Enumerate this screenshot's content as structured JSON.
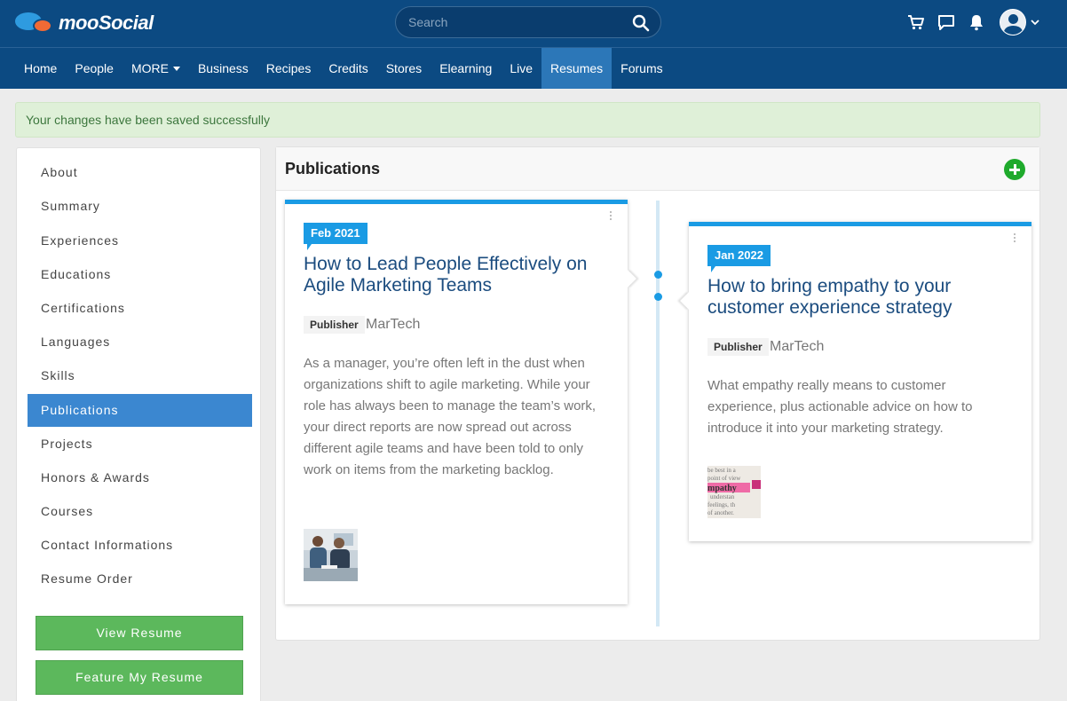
{
  "app": {
    "logo_text": "mooSocial",
    "search_placeholder": "Search"
  },
  "nav": {
    "items": [
      "Home",
      "People",
      "MORE",
      "Business",
      "Recipes",
      "Credits",
      "Stores",
      "Elearning",
      "Live",
      "Resumes",
      "Forums"
    ],
    "active": "Resumes"
  },
  "alert": {
    "message": "Your changes have been saved successfully"
  },
  "sidebar": {
    "items": [
      "About",
      "Summary",
      "Experiences",
      "Educations",
      "Certifications",
      "Languages",
      "Skills",
      "Publications",
      "Projects",
      "Honors & Awards",
      "Courses",
      "Contact Informations",
      "Resume Order"
    ],
    "active": "Publications",
    "view_resume_label": "View Resume",
    "feature_resume_label": "Feature My Resume"
  },
  "panel": {
    "title": "Publications"
  },
  "publications": [
    {
      "date": "Feb 2021",
      "title": "How to Lead People Effectively on Agile Marketing Teams",
      "publisher_label": "Publisher",
      "publisher": "MarTech",
      "description": "As a manager, you’re often left in the dust when organizations shift to agile marketing. While your role has always been to manage the team’s work, your direct reports are now spread out across different agile teams and have been told to only work on items from the marketing backlog."
    },
    {
      "date": "Jan 2022",
      "title": "How to bring empathy to your customer experience strategy",
      "publisher_label": "Publisher",
      "publisher": "MarTech",
      "description": "What empathy really means to customer experience, plus actionable advice on how to introduce it into your marketing strategy.",
      "thumb_words": [
        "be best in a",
        "point of view",
        "mpathy",
        "understan",
        "feelings, th",
        "of another."
      ]
    }
  ],
  "colors": {
    "header_bg": "#0c4a82",
    "nav_active": "#2c77b8",
    "accent": "#1a9be4",
    "sidebar_active": "#3b87d0",
    "button_green": "#5cb85c",
    "add_green": "#1faa2c"
  }
}
